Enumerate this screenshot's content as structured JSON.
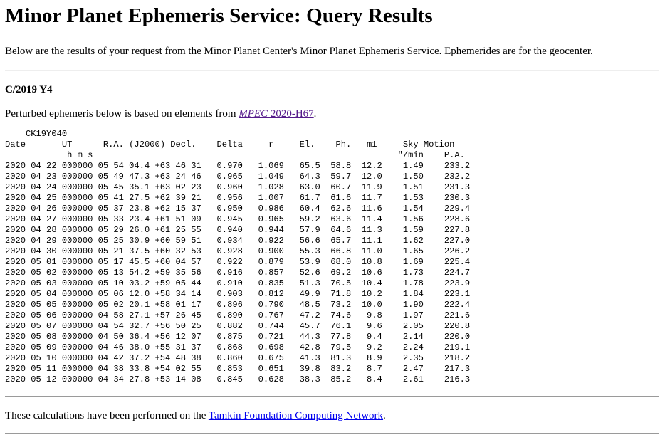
{
  "page": {
    "title": "Minor Planet Ephemeris Service: Query Results",
    "intro": "Below are the results of your request from the Minor Planet Center's Minor Planet Ephemeris Service. Ephemerides are for the geocenter.",
    "object_name": "C/2019 Y4",
    "perturbed_prefix": "Perturbed ephemeris below is based on elements from ",
    "mpec_link_italic": "MPEC",
    "mpec_link_rest": " 2020-H67",
    "perturbed_suffix": ".",
    "footer_prefix": "These calculations have been performed on the ",
    "footer_link": "Tamkin Foundation Computing Network",
    "footer_suffix": "."
  },
  "ephemeris": {
    "designation": "    CK19Y040",
    "header1": "Date       UT      R.A. (J2000) Decl.    Delta     r     El.    Ph.   m1     Sky Motion",
    "header2": "            h m s                                                           \"/min    P.A.",
    "rows": [
      "2020 04 22 000000 05 54 04.4 +63 46 31   0.970   1.069   65.5  58.8  12.2    1.49    233.2",
      "2020 04 23 000000 05 49 47.3 +63 24 46   0.965   1.049   64.3  59.7  12.0    1.50    232.2",
      "2020 04 24 000000 05 45 35.1 +63 02 23   0.960   1.028   63.0  60.7  11.9    1.51    231.3",
      "2020 04 25 000000 05 41 27.5 +62 39 21   0.956   1.007   61.7  61.6  11.7    1.53    230.3",
      "2020 04 26 000000 05 37 23.8 +62 15 37   0.950   0.986   60.4  62.6  11.6    1.54    229.4",
      "2020 04 27 000000 05 33 23.4 +61 51 09   0.945   0.965   59.2  63.6  11.4    1.56    228.6",
      "2020 04 28 000000 05 29 26.0 +61 25 55   0.940   0.944   57.9  64.6  11.3    1.59    227.8",
      "2020 04 29 000000 05 25 30.9 +60 59 51   0.934   0.922   56.6  65.7  11.1    1.62    227.0",
      "2020 04 30 000000 05 21 37.5 +60 32 53   0.928   0.900   55.3  66.8  11.0    1.65    226.2",
      "2020 05 01 000000 05 17 45.5 +60 04 57   0.922   0.879   53.9  68.0  10.8    1.69    225.4",
      "2020 05 02 000000 05 13 54.2 +59 35 56   0.916   0.857   52.6  69.2  10.6    1.73    224.7",
      "2020 05 03 000000 05 10 03.2 +59 05 44   0.910   0.835   51.3  70.5  10.4    1.78    223.9",
      "2020 05 04 000000 05 06 12.0 +58 34 14   0.903   0.812   49.9  71.8  10.2    1.84    223.1",
      "2020 05 05 000000 05 02 20.1 +58 01 17   0.896   0.790   48.5  73.2  10.0    1.90    222.4",
      "2020 05 06 000000 04 58 27.1 +57 26 45   0.890   0.767   47.2  74.6   9.8    1.97    221.6",
      "2020 05 07 000000 04 54 32.7 +56 50 25   0.882   0.744   45.7  76.1   9.6    2.05    220.8",
      "2020 05 08 000000 04 50 36.4 +56 12 07   0.875   0.721   44.3  77.8   9.4    2.14    220.0",
      "2020 05 09 000000 04 46 38.0 +55 31 37   0.868   0.698   42.8  79.5   9.2    2.24    219.1",
      "2020 05 10 000000 04 42 37.2 +54 48 38   0.860   0.675   41.3  81.3   8.9    2.35    218.2",
      "2020 05 11 000000 04 38 33.8 +54 02 55   0.853   0.651   39.8  83.2   8.7    2.47    217.3",
      "2020 05 12 000000 04 34 27.8 +53 14 08   0.845   0.628   38.3  85.2   8.4    2.61    216.3"
    ]
  },
  "colors": {
    "link": "#0000ee",
    "visited_link": "#551a8b",
    "rule": "#9a9a9a"
  }
}
